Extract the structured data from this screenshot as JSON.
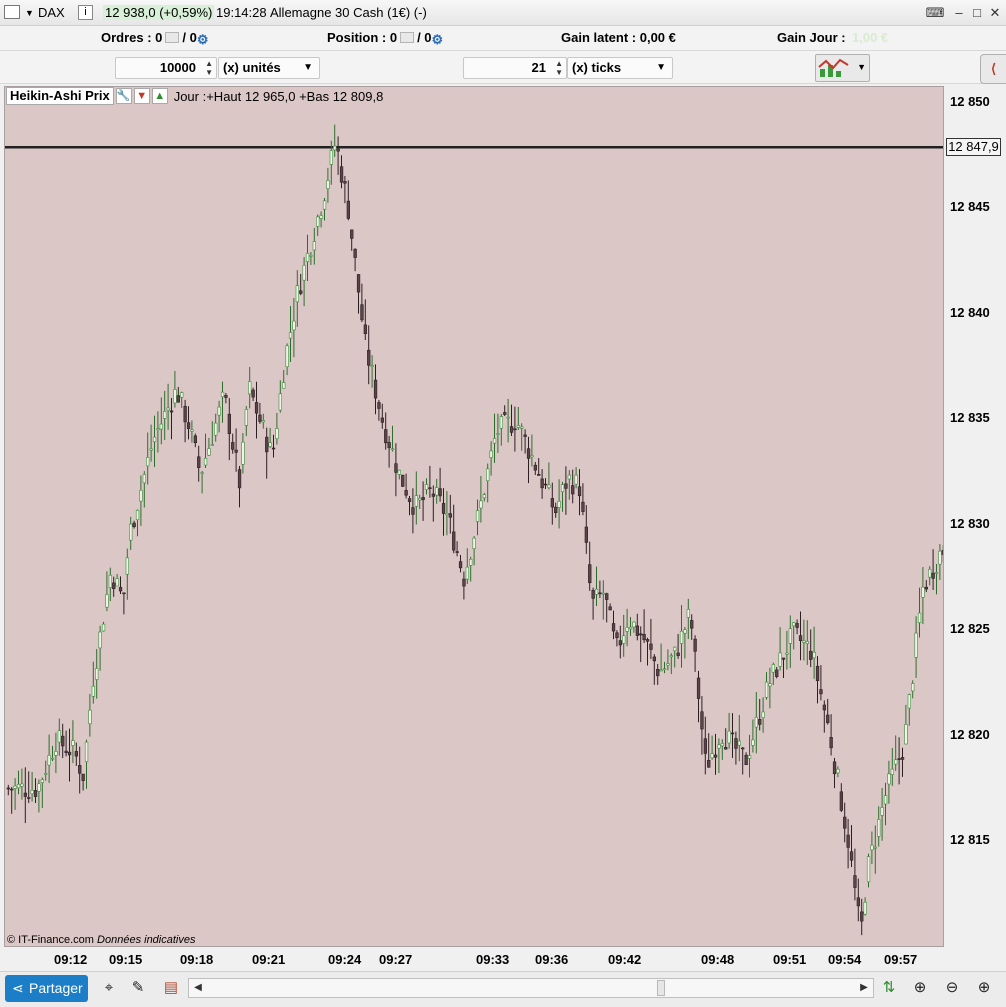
{
  "titlebar": {
    "instrument": "DAX",
    "quote": "12 938,0 (+0,59%)",
    "time": "19:14:28",
    "name": "Allemagne 30 Cash (1€) (-)"
  },
  "orders_bar": {
    "ordres_label": "Ordres : 0",
    "ordres_sep": "/ 0",
    "position_label": "Position : 0",
    "position_sep": "/ 0",
    "gain_latent": "Gain latent : 0,00 €",
    "gain_jour_label": "Gain Jour :",
    "gain_jour_value": "1,00 €"
  },
  "qty_bar": {
    "quantity": "10000",
    "quantity_unit": "(x) unités",
    "ticks": "21",
    "ticks_unit": "(x) ticks"
  },
  "legend": {
    "indicator": "Heikin-Ashi Prix",
    "day_info": "Jour :+Haut 12 965,0 +Bas 12 809,8"
  },
  "price_tag": "12 847,9",
  "credit": {
    "source": "© IT-Finance.com",
    "note": "Données indicatives"
  },
  "share_label": "Partager",
  "colors": {
    "chart_bg": "#dcc7c7",
    "up_body": "#eef4e4",
    "up_wick": "#2d6e2d",
    "down_body": "#5b4349",
    "price_line": "#222222",
    "share_blue": "#1c7ec7"
  },
  "chart_data": {
    "type": "candlestick",
    "title": "Heikin-Ashi Prix",
    "ylim": [
      12809,
      12853
    ],
    "yticks": [
      "12 850",
      "12 845",
      "12 840",
      "12 835",
      "12 830",
      "12 825",
      "12 820",
      "12 815"
    ],
    "ytick_values": [
      12850,
      12845,
      12840,
      12835,
      12830,
      12825,
      12820,
      12815
    ],
    "xticks": [
      "09:12",
      "09:15",
      "09:18",
      "09:21",
      "09:24",
      "09:27",
      "09:33",
      "09:36",
      "09:42",
      "09:48",
      "09:51",
      "09:54",
      "09:57"
    ],
    "current_price": 12847.9,
    "close_path": [
      {
        "x": "09:10",
        "y": 12817.5
      },
      {
        "x": "09:11",
        "y": 12819.8
      },
      {
        "x": "09:12",
        "y": 12819.2
      },
      {
        "x": "09:12:30",
        "y": 12818.1
      },
      {
        "x": "09:13",
        "y": 12822.6
      },
      {
        "x": "09:14",
        "y": 12827.8
      },
      {
        "x": "09:14:40",
        "y": 12826.4
      },
      {
        "x": "09:15",
        "y": 12829.5
      },
      {
        "x": "09:16",
        "y": 12834.0
      },
      {
        "x": "09:17",
        "y": 12836.4
      },
      {
        "x": "09:17:30",
        "y": 12834.8
      },
      {
        "x": "09:18",
        "y": 12832.4
      },
      {
        "x": "09:19",
        "y": 12836.1
      },
      {
        "x": "09:19:40",
        "y": 12831.8
      },
      {
        "x": "09:20",
        "y": 12836.6
      },
      {
        "x": "09:21",
        "y": 12833.2
      },
      {
        "x": "09:21:30",
        "y": 12837.8
      },
      {
        "x": "09:22",
        "y": 12841.0
      },
      {
        "x": "09:23",
        "y": 12845.5
      },
      {
        "x": "09:23:30",
        "y": 12848.2
      },
      {
        "x": "09:24",
        "y": 12845.0
      },
      {
        "x": "09:25",
        "y": 12838.5
      },
      {
        "x": "09:26",
        "y": 12835.0
      },
      {
        "x": "09:27",
        "y": 12832.4
      },
      {
        "x": "09:28",
        "y": 12830.8
      },
      {
        "x": "09:29",
        "y": 12831.6
      },
      {
        "x": "09:30",
        "y": 12830.4
      },
      {
        "x": "09:31",
        "y": 12827.5
      },
      {
        "x": "09:32",
        "y": 12830.8
      },
      {
        "x": "09:33",
        "y": 12834.4
      },
      {
        "x": "09:34",
        "y": 12835.0
      },
      {
        "x": "09:35",
        "y": 12832.8
      },
      {
        "x": "09:36",
        "y": 12830.6
      },
      {
        "x": "09:37",
        "y": 12832.2
      },
      {
        "x": "09:38",
        "y": 12831.8
      },
      {
        "x": "09:39",
        "y": 12826.2
      },
      {
        "x": "09:40",
        "y": 12826.8
      },
      {
        "x": "09:41",
        "y": 12824.0
      },
      {
        "x": "09:42",
        "y": 12825.6
      },
      {
        "x": "09:43",
        "y": 12824.6
      },
      {
        "x": "09:44",
        "y": 12823.0
      },
      {
        "x": "09:45",
        "y": 12823.8
      },
      {
        "x": "09:46",
        "y": 12825.8
      },
      {
        "x": "09:47",
        "y": 12818.5
      },
      {
        "x": "09:48",
        "y": 12820.2
      },
      {
        "x": "09:49",
        "y": 12818.8
      },
      {
        "x": "09:50",
        "y": 12822.5
      },
      {
        "x": "09:51",
        "y": 12824.8
      },
      {
        "x": "09:52",
        "y": 12824.0
      },
      {
        "x": "09:53",
        "y": 12820.0
      },
      {
        "x": "09:54",
        "y": 12815.0
      },
      {
        "x": "09:54:40",
        "y": 12810.5
      },
      {
        "x": "09:55",
        "y": 12813.5
      },
      {
        "x": "09:56",
        "y": 12817.2
      },
      {
        "x": "09:57",
        "y": 12819.6
      },
      {
        "x": "09:58",
        "y": 12827.0
      },
      {
        "x": "09:59",
        "y": 12828.8
      }
    ]
  }
}
